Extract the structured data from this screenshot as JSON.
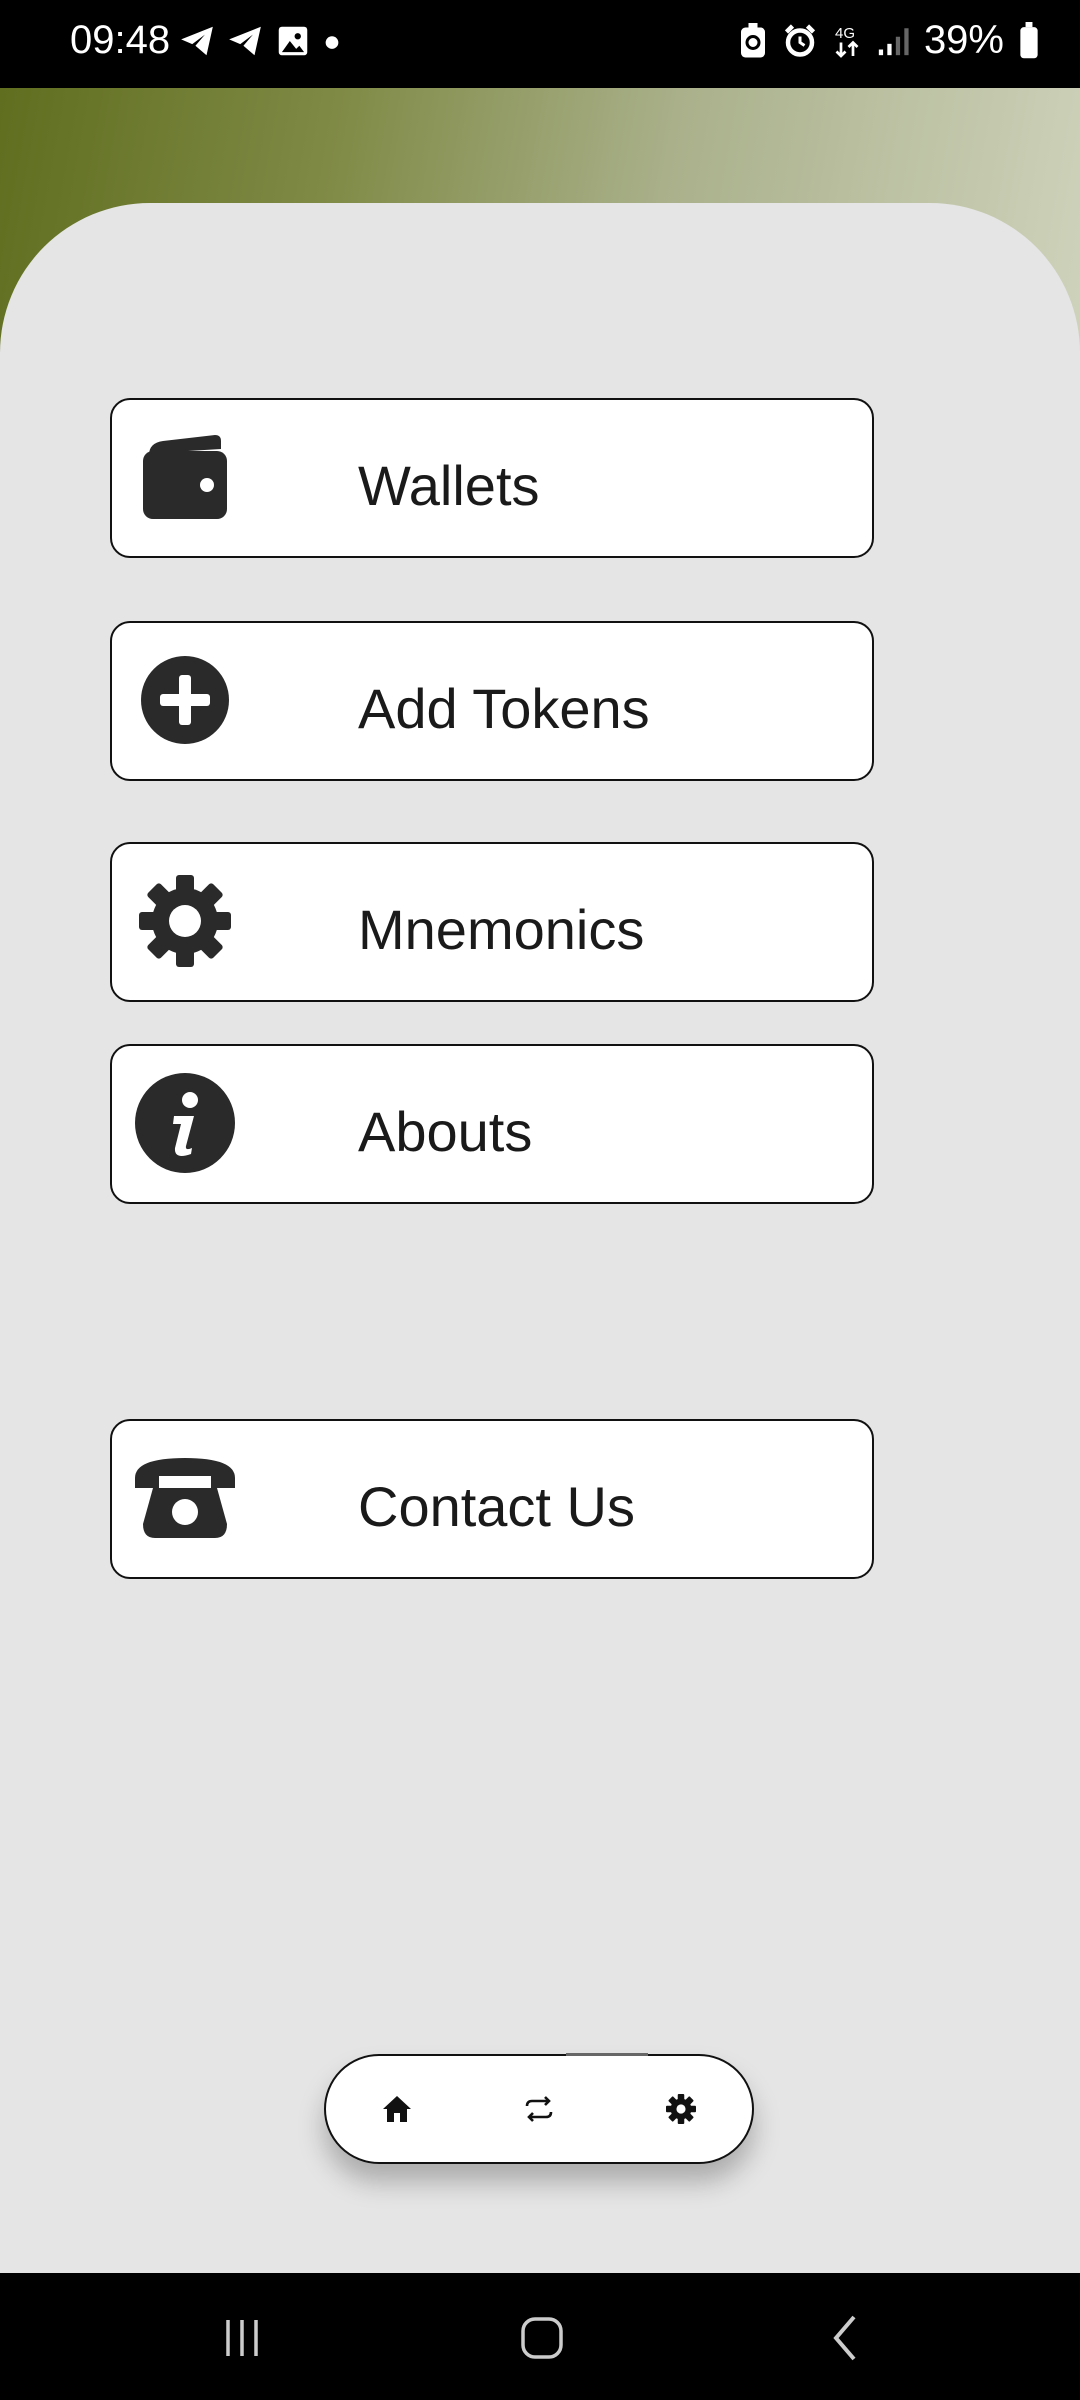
{
  "status_bar": {
    "time": "09:48",
    "left_icons": [
      "telegram-icon",
      "telegram-icon",
      "gallery-icon",
      "dot-icon"
    ],
    "right_icons": [
      "battery-saver-icon",
      "alarm-icon",
      "network-4g-icon",
      "signal-icon"
    ],
    "battery_text": "39%"
  },
  "theme": {
    "accent_start": "#5f6e1f",
    "accent_end": "#cfd3bc",
    "panel_bg": "#e5e5e5"
  },
  "menu": {
    "wallets": {
      "label": "Wallets",
      "icon": "wallet-icon"
    },
    "add_tokens": {
      "label": "Add Tokens",
      "icon": "plus-circle-icon"
    },
    "mnemonics": {
      "label": "Mnemonics",
      "icon": "gear-icon"
    },
    "abouts": {
      "label": "Abouts",
      "icon": "info-icon"
    },
    "contact_us": {
      "label": "Contact Us",
      "icon": "phone-icon"
    }
  },
  "bottom_nav": {
    "items": [
      "home-icon",
      "swap-icon",
      "settings-icon"
    ],
    "active": "swap-icon"
  },
  "system_nav": [
    "recents-button",
    "home-button",
    "back-button"
  ]
}
